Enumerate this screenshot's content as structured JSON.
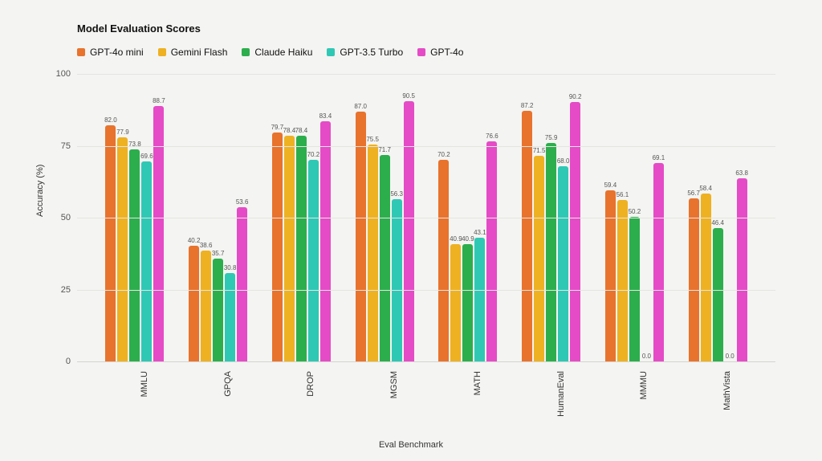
{
  "chart_data": {
    "type": "bar",
    "title": "Model Evaluation Scores",
    "xlabel": "Eval Benchmark",
    "ylabel": "Accuracy (%)",
    "ylim": [
      0,
      100
    ],
    "yticks": [
      0,
      25,
      50,
      75,
      100
    ],
    "categories": [
      "MMLU",
      "GPQA",
      "DROP",
      "MGSM",
      "MATH",
      "HumanEval",
      "MMMU",
      "MathVista"
    ],
    "series": [
      {
        "name": "GPT-4o mini",
        "color": "#e8732d",
        "values": [
          82.0,
          40.2,
          79.7,
          87.0,
          70.2,
          87.2,
          59.4,
          56.7
        ]
      },
      {
        "name": "Gemini Flash",
        "color": "#eeb121",
        "values": [
          77.9,
          38.6,
          78.4,
          75.5,
          40.9,
          71.5,
          56.1,
          58.4
        ]
      },
      {
        "name": "Claude Haiku",
        "color": "#2cae4c",
        "values": [
          73.8,
          35.7,
          78.4,
          71.7,
          40.9,
          75.9,
          50.2,
          46.4
        ]
      },
      {
        "name": "GPT-3.5 Turbo",
        "color": "#2fc8b5",
        "values": [
          69.6,
          30.8,
          70.2,
          56.3,
          43.1,
          68.0,
          0.0,
          0.0
        ]
      },
      {
        "name": "GPT-4o",
        "color": "#e54bc6",
        "values": [
          88.7,
          53.6,
          83.4,
          90.5,
          76.6,
          90.2,
          69.1,
          63.8
        ]
      }
    ],
    "legend_position": "top"
  }
}
